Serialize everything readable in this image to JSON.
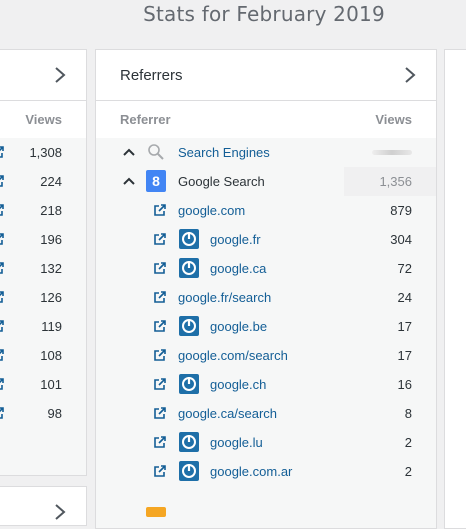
{
  "page": {
    "title": "Stats for February 2019"
  },
  "left_card": {
    "views_header": "Views",
    "values": [
      "1,308",
      "224",
      "218",
      "196",
      "132",
      "126",
      "119",
      "108",
      "101",
      "98"
    ]
  },
  "referrers": {
    "title": "Referrers",
    "col_referrer": "Referrer",
    "col_views": "Views",
    "search_engines": {
      "label": "Search Engines"
    },
    "google_search": {
      "label": "Google Search",
      "views": "1,356",
      "icon_letter": "8"
    },
    "items": [
      {
        "label": "google.com",
        "views": "879",
        "has_site_icon": false
      },
      {
        "label": "google.fr",
        "views": "304",
        "has_site_icon": true
      },
      {
        "label": "google.ca",
        "views": "72",
        "has_site_icon": true
      },
      {
        "label": "google.fr/search",
        "views": "24",
        "has_site_icon": false
      },
      {
        "label": "google.be",
        "views": "17",
        "has_site_icon": true
      },
      {
        "label": "google.com/search",
        "views": "17",
        "has_site_icon": false
      },
      {
        "label": "google.ch",
        "views": "16",
        "has_site_icon": true
      },
      {
        "label": "google.ca/search",
        "views": "8",
        "has_site_icon": false
      },
      {
        "label": "google.lu",
        "views": "2",
        "has_site_icon": true
      },
      {
        "label": "google.com.ar",
        "views": "2",
        "has_site_icon": true
      }
    ]
  },
  "colors": {
    "link": "#135e96",
    "accent": "#1e6fa8",
    "google": "#4285f4"
  }
}
